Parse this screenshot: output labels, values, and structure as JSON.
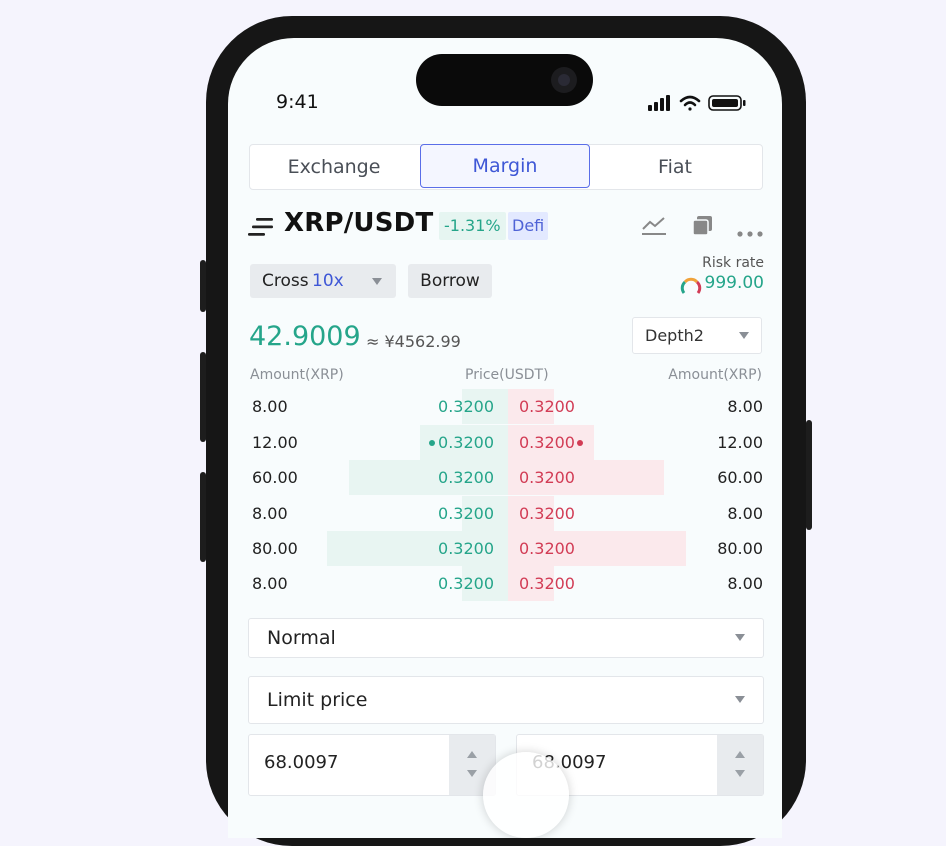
{
  "status_bar": {
    "time": "9:41"
  },
  "tabs": [
    {
      "label": "Exchange",
      "active": false
    },
    {
      "label": "Margin",
      "active": true
    },
    {
      "label": "Fiat",
      "active": false
    }
  ],
  "header": {
    "pair": "XRP/USDT",
    "change": "-1.31%",
    "tag": "Defi",
    "icons": [
      "menu-icon",
      "chart-line-icon",
      "copy-icon",
      "more-icon"
    ]
  },
  "margin": {
    "mode_label": "Cross",
    "leverage": "10x",
    "borrow_label": "Borrow",
    "risk_label": "Risk rate",
    "risk_value": "999.00"
  },
  "ticker": {
    "last_price": "42.9009",
    "fiat_value": "≈ ¥4562.99",
    "depth_label": "Depth2"
  },
  "orderbook": {
    "headers": {
      "left_amount": "Amount(XRP)",
      "price": "Price(USDT)",
      "right_amount": "Amount(XRP)"
    },
    "rows": [
      {
        "bid_amount": "8.00",
        "bid_price": "0.3200",
        "ask_price": "0.3200",
        "ask_amount": "8.00",
        "marker": false
      },
      {
        "bid_amount": "12.00",
        "bid_price": "0.3200",
        "ask_price": "0.3200",
        "ask_amount": "12.00",
        "marker": true
      },
      {
        "bid_amount": "60.00",
        "bid_price": "0.3200",
        "ask_price": "0.3200",
        "ask_amount": "60.00",
        "marker": false
      },
      {
        "bid_amount": "8.00",
        "bid_price": "0.3200",
        "ask_price": "0.3200",
        "ask_amount": "8.00",
        "marker": false
      },
      {
        "bid_amount": "80.00",
        "bid_price": "0.3200",
        "ask_price": "0.3200",
        "ask_amount": "80.00",
        "marker": false
      },
      {
        "bid_amount": "8.00",
        "bid_price": "0.3200",
        "ask_price": "0.3200",
        "ask_amount": "8.00",
        "marker": false
      }
    ],
    "colors": {
      "bid": "#25a58a",
      "ask": "#d23c55"
    }
  },
  "order_form": {
    "type_select": "Normal",
    "price_type_select": "Limit price",
    "price_value": "68.0097",
    "amount_value": "68.0097"
  }
}
